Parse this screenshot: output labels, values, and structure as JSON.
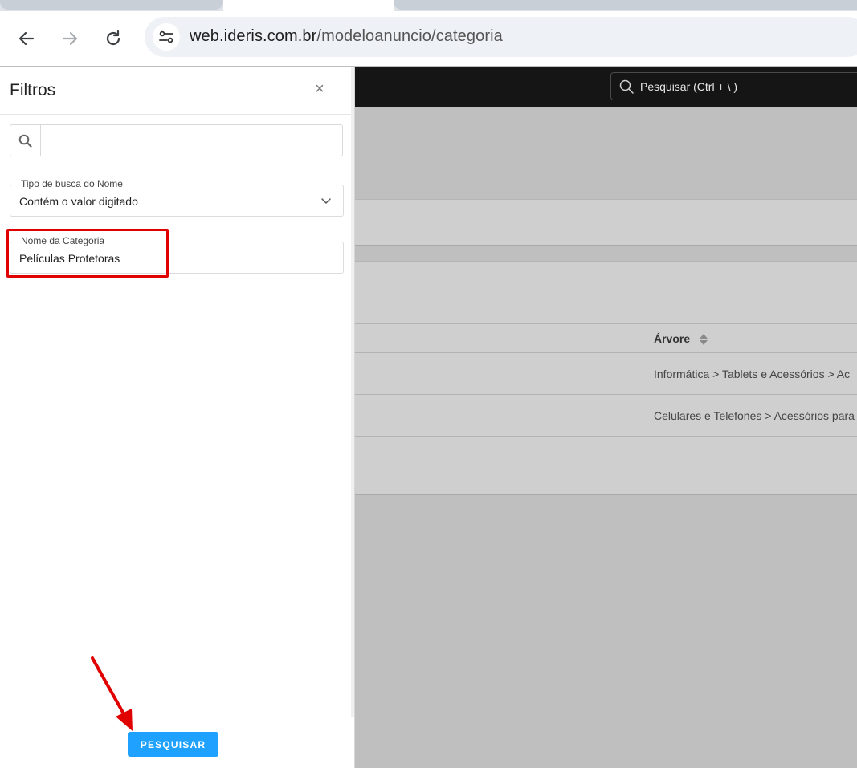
{
  "browser": {
    "url_domain": "web.ideris.com.br",
    "url_path": "/modeloanuncio/categoria"
  },
  "app": {
    "search_placeholder": "Pesquisar (Ctrl + \\ )",
    "table": {
      "column_header": "Árvore",
      "rows": [
        "Informática > Tablets e Acessórios > Ac",
        "Celulares e Telefones > Acessórios para"
      ]
    }
  },
  "filters": {
    "title": "Filtros",
    "close_symbol": "×",
    "search_value": "",
    "search_type": {
      "legend": "Tipo de busca do Nome",
      "value": "Contém o valor digitado"
    },
    "category_name": {
      "legend": "Nome da Categoria",
      "value": "Películas Protetoras"
    },
    "submit_label": "PESQUISAR"
  },
  "colors": {
    "primary_button": "#1ea1ff",
    "annotation": "#e00000",
    "overlay_dim": "#bfbfbf",
    "header_dark": "#151515"
  }
}
